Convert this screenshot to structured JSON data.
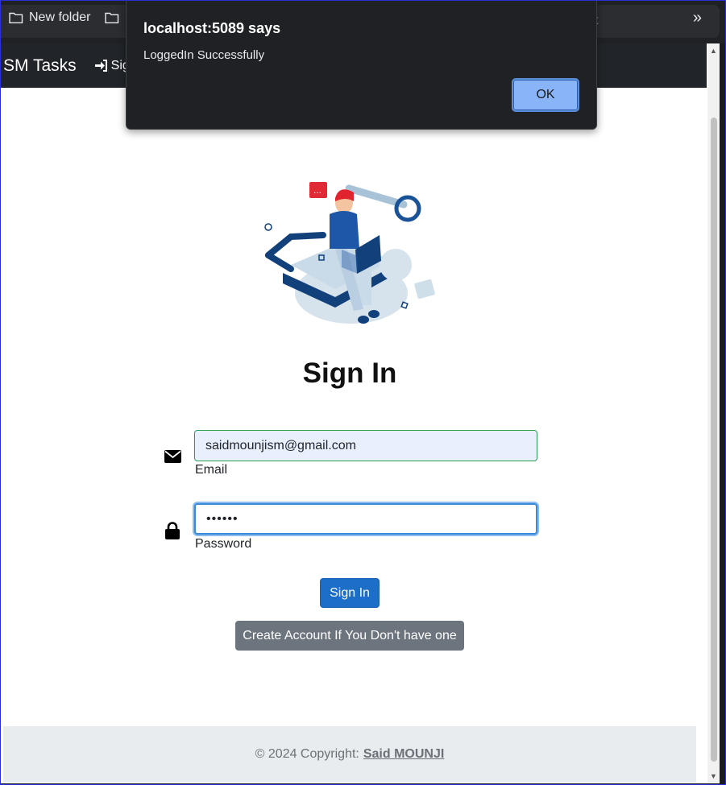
{
  "bookmarks": {
    "items": [
      {
        "label": "New folder",
        "icon": "folder-icon"
      },
      {
        "label": "",
        "icon": "folder-icon"
      }
    ],
    "overflow_text": "t",
    "more_icon": "chevron-double-right-icon"
  },
  "navbar": {
    "brand": "SM Tasks",
    "signin_label": "Sign"
  },
  "illustration": {
    "icon": "login-illustration"
  },
  "form": {
    "title": "Sign In",
    "email_value": "saidmounjism@gmail.com",
    "email_label": "Email",
    "password_value": "••••••",
    "password_label": "Password",
    "submit_label": "Sign In",
    "create_account_label": "Create Account If You Don't have one"
  },
  "footer": {
    "copyright": "© 2024 Copyright:",
    "author": "Said MOUNJI"
  },
  "dialog": {
    "title": "localhost:5089 says",
    "message": "LoggedIn Successfully",
    "ok_label": "OK"
  },
  "colors": {
    "primary": "#1c6ec7",
    "secondary": "#6c757d",
    "navbar_bg": "#212529",
    "dialog_bg": "#1f2124",
    "ok_button": "#8ab4f8"
  }
}
